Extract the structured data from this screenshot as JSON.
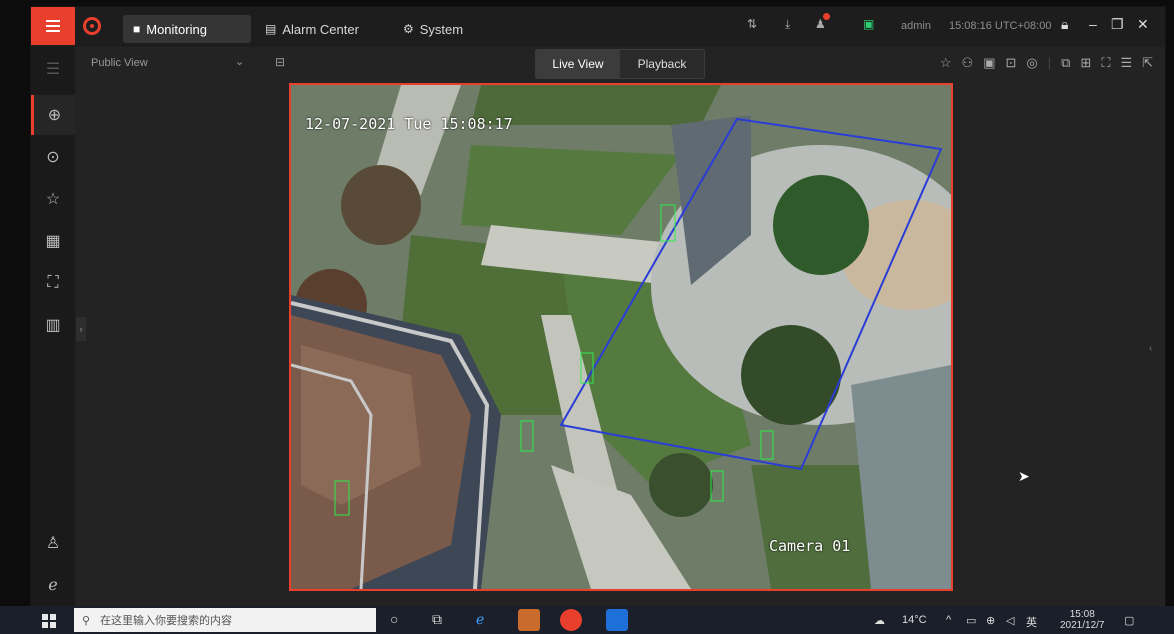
{
  "app": {
    "tabs": [
      {
        "label": "Monitoring",
        "icon": "camera-icon",
        "active": true
      },
      {
        "label": "Alarm Center",
        "icon": "document-icon",
        "active": false
      },
      {
        "label": "System",
        "icon": "gear-icon",
        "active": false
      }
    ],
    "user": "admin",
    "datetime": "15:08:16 UTC+08:00",
    "alarm_badge_color": "#e8402c",
    "accent": "#e8402c"
  },
  "view": {
    "selector": "Public View",
    "modes": [
      {
        "label": "Live View",
        "active": true
      },
      {
        "label": "Playback",
        "active": false
      }
    ]
  },
  "camera": {
    "osd_datetime": "12-07-2021 Tue 15:08:17",
    "name": "Camera 01"
  },
  "taskbar": {
    "search_placeholder": "在这里输入你要搜索的内容",
    "weather": "14°C",
    "time": "15:08",
    "date": "2021/12/7"
  }
}
